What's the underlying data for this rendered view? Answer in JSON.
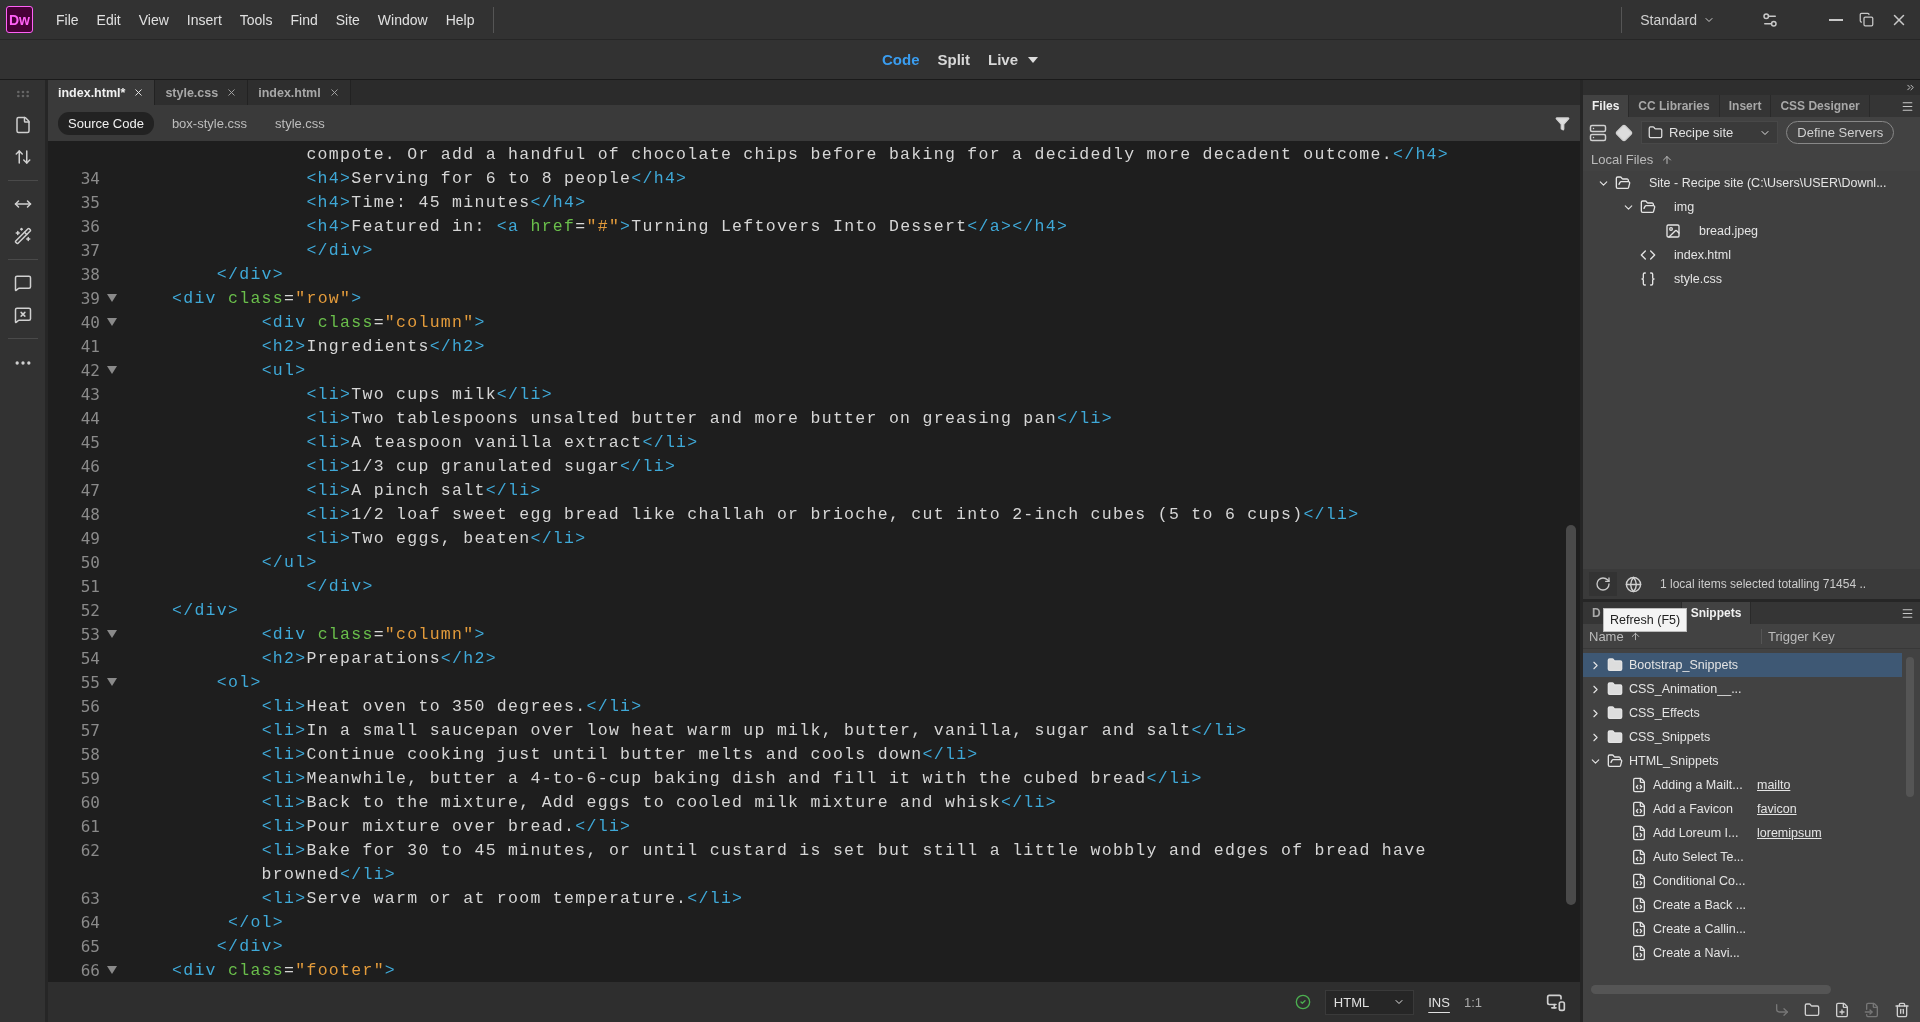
{
  "app": {
    "logo": "Dw",
    "menu": [
      "File",
      "Edit",
      "View",
      "Insert",
      "Tools",
      "Find",
      "Site",
      "Window",
      "Help"
    ],
    "workspace": "Standard"
  },
  "view_modes": [
    {
      "label": "Code",
      "selected": true
    },
    {
      "label": "Split",
      "selected": false
    },
    {
      "label": "Live",
      "selected": false
    }
  ],
  "document_tabs": [
    {
      "label": "index.html*",
      "selected": true
    },
    {
      "label": "style.css",
      "selected": false
    },
    {
      "label": "index.html",
      "selected": false
    }
  ],
  "related_files": [
    {
      "label": "Source Code",
      "selected": true
    },
    {
      "label": "box-style.css",
      "selected": false
    },
    {
      "label": "style.css",
      "selected": false
    }
  ],
  "code_lines": [
    {
      "text": "            compote. Or add a handful of chocolate chips before baking for a decidedly more decadent outcome.</h4>"
    },
    {
      "number": "34",
      "fold": false,
      "text": "            <h4>Serving for 6 to 8 people</h4>"
    },
    {
      "number": "35",
      "fold": false,
      "text": "            <h4>Time: 45 minutes</h4>"
    },
    {
      "number": "36",
      "fold": false,
      "text": "            <h4>Featured in: <a href=\"#\">Turning Leftovers Into Dessert</a></h4>"
    },
    {
      "number": "37",
      "fold": false,
      "text": "            </div>"
    },
    {
      "number": "38",
      "fold": false,
      "text": "    </div>"
    },
    {
      "number": "39",
      "fold": true,
      "text": "<div class=\"row\">"
    },
    {
      "number": "40",
      "fold": true,
      "text": "        <div class=\"column\">"
    },
    {
      "number": "41",
      "fold": false,
      "text": "        <h2>Ingredients</h2>"
    },
    {
      "number": "42",
      "fold": true,
      "text": "        <ul>"
    },
    {
      "number": "43",
      "fold": false,
      "text": "            <li>Two cups milk</li>"
    },
    {
      "number": "44",
      "fold": false,
      "text": "            <li>Two tablespoons unsalted butter and more butter on greasing pan</li>"
    },
    {
      "number": "45",
      "fold": false,
      "text": "            <li>A teaspoon vanilla extract</li>"
    },
    {
      "number": "46",
      "fold": false,
      "text": "            <li>1/3 cup granulated sugar</li>"
    },
    {
      "number": "47",
      "fold": false,
      "text": "            <li>A pinch salt</li>"
    },
    {
      "number": "48",
      "fold": false,
      "text": "            <li>1/2 loaf sweet egg bread like challah or brioche, cut into 2-inch cubes (5 to 6 cups)</li>"
    },
    {
      "number": "49",
      "fold": false,
      "text": "            <li>Two eggs, beaten</li>"
    },
    {
      "number": "50",
      "fold": false,
      "text": "        </ul>"
    },
    {
      "number": "51",
      "fold": false,
      "text": "            </div>"
    },
    {
      "number": "52",
      "fold": false,
      "text": "</div>"
    },
    {
      "number": "53",
      "fold": true,
      "text": "        <div class=\"column\">"
    },
    {
      "number": "54",
      "fold": false,
      "text": "        <h2>Preparations</h2>"
    },
    {
      "number": "55",
      "fold": true,
      "text": "    <ol>"
    },
    {
      "number": "56",
      "fold": false,
      "text": "        <li>Heat oven to 350 degrees.</li>"
    },
    {
      "number": "57",
      "fold": false,
      "text": "        <li>In a small saucepan over low heat warm up milk, butter, vanilla, sugar and salt</li>"
    },
    {
      "number": "58",
      "fold": false,
      "text": "        <li>Continue cooking just until butter melts and cools down</li>"
    },
    {
      "number": "59",
      "fold": false,
      "text": "        <li>Meanwhile, butter a 4-to-6-cup baking dish and fill it with the cubed bread</li>"
    },
    {
      "number": "60",
      "fold": false,
      "text": "        <li>Back to the mixture, Add eggs to cooled milk mixture and whisk</li>"
    },
    {
      "number": "61",
      "fold": false,
      "text": "        <li>Pour mixture over bread.</li>"
    },
    {
      "number": "62",
      "fold": false,
      "text": "        <li>Bake for 30 to 45 minutes, or until custard is set but still a little wobbly and edges of bread have",
      "continuation": "        browned</li>"
    },
    {
      "number": "63",
      "fold": false,
      "text": "        <li>Serve warm or at room temperature.</li>"
    },
    {
      "number": "64",
      "fold": false,
      "text": "     </ol>"
    },
    {
      "number": "65",
      "fold": false,
      "text": "    </div>"
    },
    {
      "number": "66",
      "fold": true,
      "text": "<div class=\"footer\">"
    }
  ],
  "status_bar": {
    "language": "HTML",
    "mode": "INS",
    "position": "1:1"
  },
  "files_panel": {
    "tabs": [
      {
        "label": "Files",
        "selected": true
      },
      {
        "label": "CC Libraries",
        "selected": false
      },
      {
        "label": "Insert",
        "selected": false
      },
      {
        "label": "CSS Designer",
        "selected": false
      }
    ],
    "site": "Recipe site",
    "define_button": "Define Servers",
    "header": "Local Files",
    "tree": [
      {
        "kind": "folder",
        "label": "Site - Recipe site (C:\\Users\\USER\\Downl...",
        "expanded": true,
        "children": [
          {
            "kind": "folder",
            "label": "img",
            "expanded": true,
            "children": [
              {
                "kind": "image",
                "label": "bread.jpeg"
              }
            ]
          },
          {
            "kind": "html",
            "label": "index.html"
          },
          {
            "kind": "css",
            "label": "style.css"
          }
        ]
      }
    ],
    "status": "1 local items selected totalling 71454 .."
  },
  "snippets_panel": {
    "tabs": [
      {
        "label": "D",
        "selected": false
      },
      {
        "label": "Snippets",
        "selected": true
      }
    ],
    "tooltip": "Refresh (F5)",
    "columns": [
      "Name",
      "Trigger Key"
    ],
    "tree": [
      {
        "kind": "folder",
        "label": "Bootstrap_Snippets",
        "expanded": false,
        "selected": true
      },
      {
        "kind": "folder",
        "label": "CSS_Animation__...",
        "expanded": false,
        "selected": false
      },
      {
        "kind": "folder",
        "label": "CSS_Effects",
        "expanded": false,
        "selected": false
      },
      {
        "kind": "folder",
        "label": "CSS_Snippets",
        "expanded": false,
        "selected": false
      },
      {
        "kind": "folder",
        "label": "HTML_Snippets",
        "expanded": true,
        "selected": false,
        "children": [
          {
            "kind": "snippet",
            "label": "Adding a Mailt...",
            "trigger": "mailto",
            "selected": false
          },
          {
            "kind": "snippet",
            "label": "Add a Favicon",
            "trigger": "favicon",
            "selected": false
          },
          {
            "kind": "snippet",
            "label": "Add Loreum I...",
            "trigger": "loremipsum",
            "selected": false
          },
          {
            "kind": "snippet",
            "label": "Auto Select Te...",
            "selected": false
          },
          {
            "kind": "snippet",
            "label": "Conditional Co...",
            "selected": false
          },
          {
            "kind": "snippet",
            "label": "Create a Back ...",
            "selected": false
          },
          {
            "kind": "snippet",
            "label": "Create a Callin...",
            "selected": false
          },
          {
            "kind": "snippet",
            "label": "Create a Navi...",
            "selected": false
          }
        ]
      }
    ]
  }
}
